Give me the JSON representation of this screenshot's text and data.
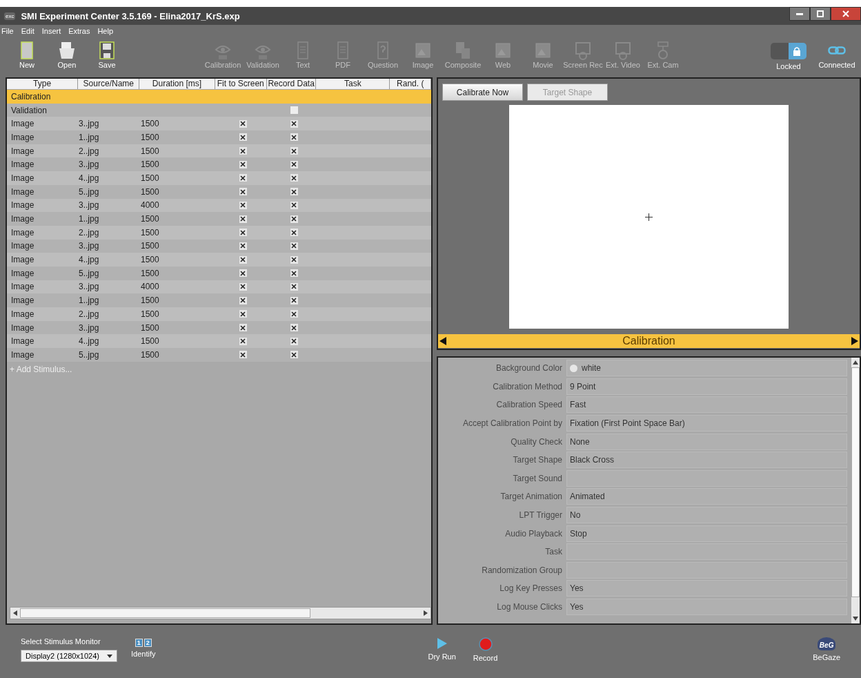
{
  "window": {
    "logo": "exc",
    "title": "SMI Experiment Center 3.5.169 - Elina2017_KrS.exp"
  },
  "menu": [
    "File",
    "Edit",
    "Insert",
    "Extras",
    "Help"
  ],
  "toolbar": [
    {
      "label": "New",
      "disabled": false
    },
    {
      "label": "Open",
      "disabled": false
    },
    {
      "label": "Save",
      "disabled": false
    },
    {
      "label": "Calibration",
      "disabled": true
    },
    {
      "label": "Validation",
      "disabled": true
    },
    {
      "label": "Text",
      "disabled": true
    },
    {
      "label": "PDF",
      "disabled": true
    },
    {
      "label": "Question",
      "disabled": true
    },
    {
      "label": "Image",
      "disabled": true
    },
    {
      "label": "Composite",
      "disabled": true
    },
    {
      "label": "Web",
      "disabled": true
    },
    {
      "label": "Movie",
      "disabled": true
    },
    {
      "label": "Screen Rec",
      "disabled": true
    },
    {
      "label": "Ext. Video",
      "disabled": true
    },
    {
      "label": "Ext. Cam",
      "disabled": true
    }
  ],
  "lock": {
    "label": "Locked",
    "on": true
  },
  "connection": {
    "label": "Connected"
  },
  "table": {
    "columns": [
      "Type",
      "Source/Name",
      "Duration [ms]",
      "Fit to Screen",
      "Record Data",
      "Task",
      "Rand. ("
    ],
    "rows": [
      {
        "type": "Calibration",
        "selected": true
      },
      {
        "type": "Validation",
        "record_data": false,
        "selected": false
      },
      {
        "type": "Image",
        "source": "3..jpg",
        "duration": "1500",
        "fit_to_screen": true,
        "record_data": true,
        "selected": false
      },
      {
        "type": "Image",
        "source": "1..jpg",
        "duration": "1500",
        "fit_to_screen": true,
        "record_data": true,
        "selected": false
      },
      {
        "type": "Image",
        "source": "2..jpg",
        "duration": "1500",
        "fit_to_screen": true,
        "record_data": true,
        "selected": false
      },
      {
        "type": "Image",
        "source": "3..jpg",
        "duration": "1500",
        "fit_to_screen": true,
        "record_data": true,
        "selected": false
      },
      {
        "type": "Image",
        "source": "4..jpg",
        "duration": "1500",
        "fit_to_screen": true,
        "record_data": true,
        "selected": false
      },
      {
        "type": "Image",
        "source": "5..jpg",
        "duration": "1500",
        "fit_to_screen": true,
        "record_data": true,
        "selected": false
      },
      {
        "type": "Image",
        "source": "3..jpg",
        "duration": "4000",
        "fit_to_screen": true,
        "record_data": true,
        "selected": false
      },
      {
        "type": "Image",
        "source": "1..jpg",
        "duration": "1500",
        "fit_to_screen": true,
        "record_data": true,
        "selected": false
      },
      {
        "type": "Image",
        "source": "2..jpg",
        "duration": "1500",
        "fit_to_screen": true,
        "record_data": true,
        "selected": false
      },
      {
        "type": "Image",
        "source": "3..jpg",
        "duration": "1500",
        "fit_to_screen": true,
        "record_data": true,
        "selected": false
      },
      {
        "type": "Image",
        "source": "4..jpg",
        "duration": "1500",
        "fit_to_screen": true,
        "record_data": true,
        "selected": false
      },
      {
        "type": "Image",
        "source": "5..jpg",
        "duration": "1500",
        "fit_to_screen": true,
        "record_data": true,
        "selected": false
      },
      {
        "type": "Image",
        "source": "3..jpg",
        "duration": "4000",
        "fit_to_screen": true,
        "record_data": true,
        "selected": false
      },
      {
        "type": "Image",
        "source": "1..jpg",
        "duration": "1500",
        "fit_to_screen": true,
        "record_data": true,
        "selected": false
      },
      {
        "type": "Image",
        "source": "2..jpg",
        "duration": "1500",
        "fit_to_screen": true,
        "record_data": true,
        "selected": false
      },
      {
        "type": "Image",
        "source": "3..jpg",
        "duration": "1500",
        "fit_to_screen": true,
        "record_data": true,
        "selected": false
      },
      {
        "type": "Image",
        "source": "4..jpg",
        "duration": "1500",
        "fit_to_screen": true,
        "record_data": true,
        "selected": false
      },
      {
        "type": "Image",
        "source": "5..jpg",
        "duration": "1500",
        "fit_to_screen": true,
        "record_data": true,
        "selected": false
      }
    ],
    "add_link": "+ Add Stimulus..."
  },
  "preview": {
    "buttons": [
      {
        "label": "Calibrate Now",
        "disabled": false
      },
      {
        "label": "Target Shape",
        "disabled": true
      }
    ],
    "nav_title": "Calibration"
  },
  "properties": [
    {
      "label": "Background Color",
      "value": "white",
      "color": "#e6e6e6"
    },
    {
      "label": "Calibration Method",
      "value": "9 Point"
    },
    {
      "label": "Calibration Speed",
      "value": "Fast"
    },
    {
      "label": "Accept Calibration Point by",
      "value": "Fixation (First Point Space Bar)"
    },
    {
      "label": "Quality Check",
      "value": "None"
    },
    {
      "label": "Target Shape",
      "value": "Black Cross"
    },
    {
      "label": "Target Sound"
    },
    {
      "label": "Target Animation",
      "value": "Animated"
    },
    {
      "label": "LPT Trigger",
      "value": "No"
    },
    {
      "label": "Audio Playback",
      "value": "Stop"
    },
    {
      "label": "Task"
    },
    {
      "label": "Randomization Group"
    },
    {
      "label": "Log Key Presses",
      "value": "Yes"
    },
    {
      "label": "Log Mouse Clicks",
      "value": "Yes"
    }
  ],
  "bottom": {
    "monitor_label": "Select Stimulus Monitor",
    "monitor_value": "Display2 (1280x1024)",
    "identify_badges": [
      "1",
      "2"
    ],
    "identify": "Identify",
    "dry_run": "Dry Run",
    "record": "Record",
    "begaze_logo": "BeG",
    "begaze": "BeGaze"
  }
}
